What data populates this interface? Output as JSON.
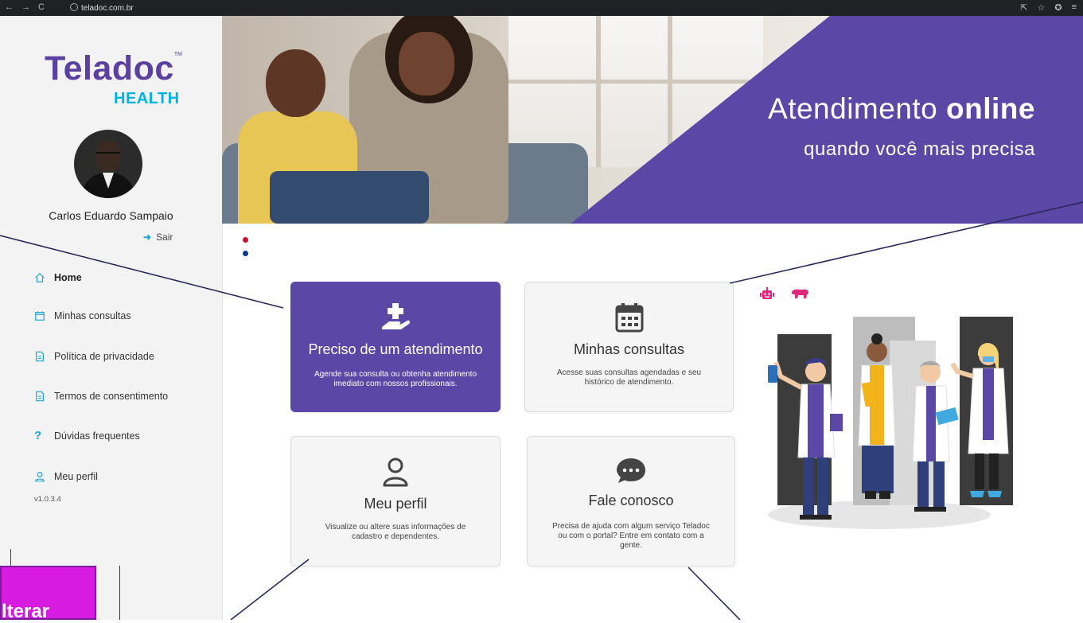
{
  "browser": {
    "url": "teladoc.com.br"
  },
  "sidebar": {
    "logo_word": "Teladoc",
    "logo_sub": "HEALTH",
    "user_name": "Carlos Eduardo Sampaio",
    "logout_label": "Sair",
    "menu": [
      {
        "label": "Home",
        "icon": "home-icon",
        "active": true
      },
      {
        "label": "Minhas consultas",
        "icon": "calendar-icon"
      },
      {
        "label": "Política de privacidade",
        "icon": "document-icon"
      },
      {
        "label": "Termos de consentimento",
        "icon": "document-icon"
      },
      {
        "label": "Dúvidas frequentes",
        "icon": "question-icon"
      },
      {
        "label": "Meu perfil",
        "icon": "user-icon"
      }
    ],
    "version": "v1.0.3.4"
  },
  "banner": {
    "title_regular": "Atendimento ",
    "title_bold": "online",
    "subtitle": "quando você mais precisa"
  },
  "cards": [
    {
      "title": "Preciso de um atendimento",
      "description": "Agende sua consulta ou obtenha atendimento imediato com nossos profissionais.",
      "icon": "hand-plus-icon"
    },
    {
      "title": "Minhas consultas",
      "description": "Acesse suas consultas agendadas e seu histórico de atendimento.",
      "icon": "calendar-icon"
    },
    {
      "title": "Meu perfil",
      "description": "Visualize ou altere suas informações de cadastro e dependentes.",
      "icon": "user-icon"
    },
    {
      "title": "Fale conosco",
      "description": "Precisa de ajuda com algum serviço Teladoc ou com o portal? Entre em contato com a gente.",
      "icon": "chat-icon"
    }
  ],
  "callout": {
    "text": "lterar"
  },
  "colors": {
    "primary": "#5a47a6",
    "accent": "#00b5e2",
    "dot_red": "#c8102e",
    "dot_blue": "#003a8c",
    "callout": "#d81be0"
  }
}
